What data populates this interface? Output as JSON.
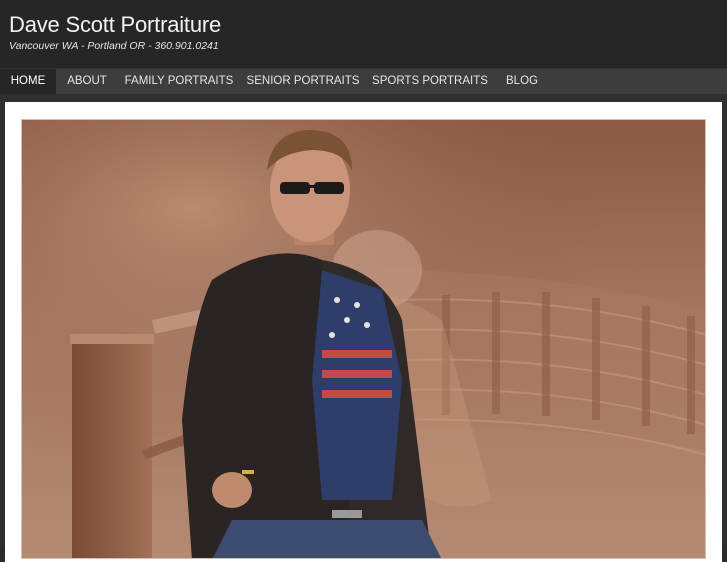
{
  "header": {
    "title": "Dave Scott Portraiture",
    "tagline": "Vancouver WA - Portland OR - 360.901.0241"
  },
  "nav": {
    "items": [
      {
        "label": "HOME",
        "active": true
      },
      {
        "label": "ABOUT",
        "active": false
      },
      {
        "label": "FAMILY PORTRAITS",
        "active": false
      },
      {
        "label": "SENIOR PORTRAITS",
        "active": false
      },
      {
        "label": "SPORTS PORTRAITS",
        "active": false
      },
      {
        "label": "BLOG",
        "active": false
      }
    ]
  },
  "colors": {
    "header_bg": "#262626",
    "nav_bg": "#3d3d3d",
    "active_nav_bg": "#262626",
    "photo_tone": "#9a6a50"
  },
  "hero": {
    "image_icon": "portrait-photo-image"
  }
}
